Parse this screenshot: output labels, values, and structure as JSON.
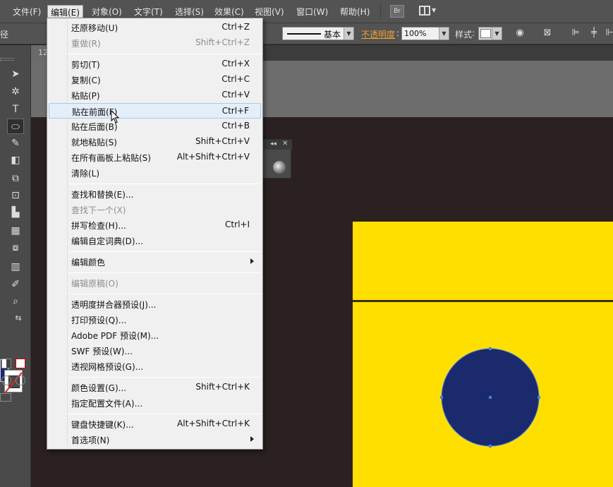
{
  "menubar": {
    "items": [
      "文件(F)",
      "编辑(E)",
      "对象(O)",
      "文字(T)",
      "选择(S)",
      "效果(C)",
      "视图(V)",
      "窗口(W)",
      "帮助(H)"
    ],
    "bridge_label": "Br"
  },
  "controlbar": {
    "left_label": "径",
    "stroke_profile": "基本",
    "opacity_label": "不透明度",
    "opacity_value": "100%",
    "style_label": "样式"
  },
  "tab": {
    "label": "12"
  },
  "edit_menu": {
    "items": [
      {
        "label": "还原移动(U)",
        "shortcut": "Ctrl+Z",
        "disabled": false
      },
      {
        "label": "重做(R)",
        "shortcut": "Shift+Ctrl+Z",
        "disabled": true
      },
      {
        "label": "剪切(T)",
        "shortcut": "Ctrl+X",
        "disabled": false
      },
      {
        "label": "复制(C)",
        "shortcut": "Ctrl+C",
        "disabled": false
      },
      {
        "label": "粘贴(P)",
        "shortcut": "Ctrl+V",
        "disabled": false
      },
      {
        "label": "贴在前面(F)",
        "shortcut": "Ctrl+F",
        "disabled": false,
        "highlighted": true
      },
      {
        "label": "贴在后面(B)",
        "shortcut": "Ctrl+B",
        "disabled": false
      },
      {
        "label": "就地粘贴(S)",
        "shortcut": "Shift+Ctrl+V",
        "disabled": false
      },
      {
        "label": "在所有画板上粘贴(S)",
        "shortcut": "Alt+Shift+Ctrl+V",
        "disabled": false
      },
      {
        "label": "清除(L)",
        "shortcut": "",
        "disabled": false
      },
      {
        "label": "查找和替换(E)...",
        "shortcut": "",
        "disabled": false
      },
      {
        "label": "查找下一个(X)",
        "shortcut": "",
        "disabled": true
      },
      {
        "label": "拼写检查(H)...",
        "shortcut": "Ctrl+I",
        "disabled": false
      },
      {
        "label": "编辑自定词典(D)...",
        "shortcut": "",
        "disabled": false
      },
      {
        "label": "编辑颜色",
        "shortcut": "",
        "disabled": false,
        "submenu": true
      },
      {
        "label": "编辑原稿(O)",
        "shortcut": "",
        "disabled": true
      },
      {
        "label": "透明度拼合器预设(J)...",
        "shortcut": "",
        "disabled": false
      },
      {
        "label": "打印预设(Q)...",
        "shortcut": "",
        "disabled": false
      },
      {
        "label": "Adobe PDF 预设(M)...",
        "shortcut": "",
        "disabled": false
      },
      {
        "label": "SWF 预设(W)...",
        "shortcut": "",
        "disabled": false
      },
      {
        "label": "透视网格预设(G)...",
        "shortcut": "",
        "disabled": false
      },
      {
        "label": "颜色设置(G)...",
        "shortcut": "Shift+Ctrl+K",
        "disabled": false
      },
      {
        "label": "指定配置文件(A)...",
        "shortcut": "",
        "disabled": false
      },
      {
        "label": "键盘快捷键(K)...",
        "shortcut": "Alt+Shift+Ctrl+K",
        "disabled": false
      },
      {
        "label": "首选项(N)",
        "shortcut": "",
        "disabled": false,
        "submenu": true
      }
    ]
  },
  "colors": {
    "artboard_fill": "#ffdf00",
    "circle_fill": "#1a2a6c",
    "selection_handle": "#4a7fd8"
  }
}
